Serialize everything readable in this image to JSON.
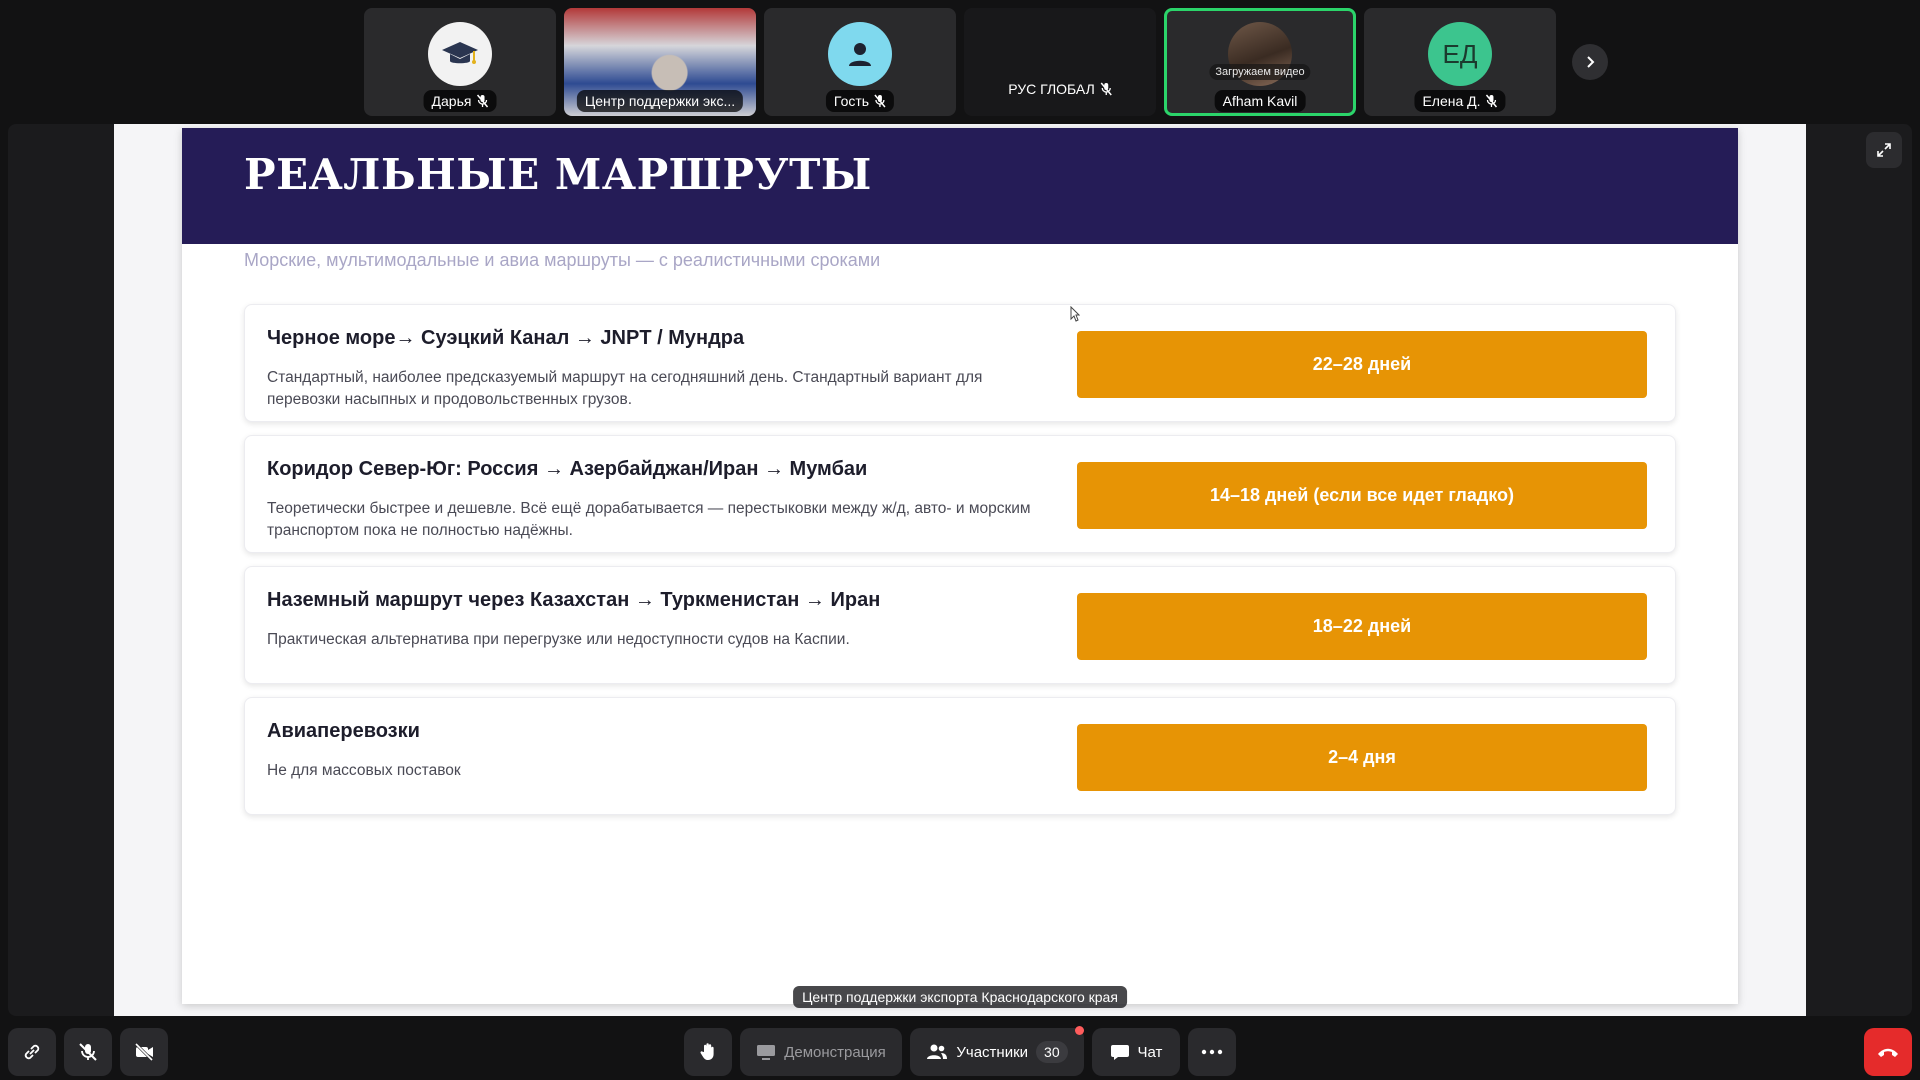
{
  "participants": [
    {
      "name": "Дарья",
      "kind": "avatar",
      "avatar_style": "white",
      "icon": "graduation-cap-icon",
      "muted": true
    },
    {
      "name": "Центр поддержки экс...",
      "kind": "video",
      "muted": false
    },
    {
      "name": "Гость",
      "kind": "avatar",
      "avatar_style": "cyan",
      "icon": "person-icon",
      "muted": true
    },
    {
      "name": "РУС ГЛОБАЛ",
      "kind": "empty",
      "muted": true
    },
    {
      "name": "Afham Kavil",
      "kind": "photo",
      "status": "Загружаем видео",
      "muted": false,
      "active": true
    },
    {
      "name": "Елена Д.",
      "kind": "initials",
      "initials": "ЕД",
      "avatar_style": "green",
      "muted": true
    }
  ],
  "slide": {
    "title": "РЕАЛЬНЫЕ МАРШРУТЫ",
    "subtitle": "Морские, мультимодальные и авиа маршруты — с реалистичными сроками",
    "routes": [
      {
        "title": "Черное море→ Суэцкий Канал → JNPT / Мундра",
        "description": "Стандартный, наиболее предсказуемый маршрут на сегодняшний день. Стандартный вариант для перевозки насыпных и продовольственных грузов.",
        "duration": "22–28 дней"
      },
      {
        "title": "Коридор Север-Юг: Россия → Азербайджан/Иран → Мумбаи",
        "description": "Теоретически быстрее и дешевле. Всё ещё дорабатывается — перестыковки между ж/д, авто- и морским транспортом пока не полностью надёжны.",
        "duration": "14–18 дней (если все идет гладко)"
      },
      {
        "title": "Наземный маршрут через Казахстан → Туркменистан → Иран",
        "description": "Практическая альтернатива при перегрузке или недоступности судов на Каспии.",
        "duration": "18–22 дней"
      },
      {
        "title": "Авиаперевозки",
        "description": "Не для массовых поставок",
        "duration": "2–4 дня"
      }
    ]
  },
  "presenter_caption": "Центр поддержки экспорта Краснодарского края",
  "toolbar": {
    "demo_label": "Демонстрация",
    "participants_label": "Участники",
    "participants_count": "30",
    "chat_label": "Чат"
  },
  "colors": {
    "header_bg": "#251c57",
    "duration_bg": "#e79405",
    "active_tile": "#2bd46a",
    "hangup": "#e52b2b"
  }
}
